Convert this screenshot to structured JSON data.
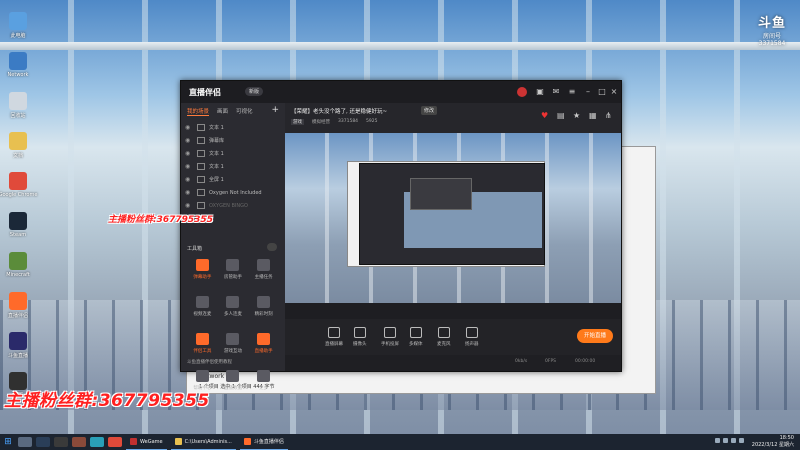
{
  "desktop": {
    "icons": [
      {
        "label": "此电脑",
        "color": "#5aa0e0"
      },
      {
        "label": "Network",
        "color": "#3b7bc4"
      },
      {
        "label": "回收站",
        "color": "#d0d8e0"
      },
      {
        "label": "文档",
        "color": "#e8c050"
      },
      {
        "label": "Google Chrome",
        "color": "#e04a3a"
      },
      {
        "label": "Steam",
        "color": "#1b2838"
      },
      {
        "label": "Minecraft",
        "color": "#5b8c3a"
      },
      {
        "label": "直播伴侣",
        "color": "#ff6a2a"
      },
      {
        "label": "斗鱼直播",
        "color": "#2a2a6a"
      },
      {
        "label": "OBS",
        "color": "#303030"
      }
    ],
    "watermark": {
      "logo": "斗鱼",
      "text": "房间号",
      "room": "3371584"
    },
    "fan_group_big": "主播粉丝群:367795355",
    "fan_group_small": "主播粉丝群:367795355"
  },
  "background_window": {
    "network_label": "Network",
    "network_sub": "1 个项目    选中 1 个项目   444 字节"
  },
  "app": {
    "logo": "直播伴侣",
    "version": "新版",
    "tabs": [
      "我的场景",
      "画面",
      "可视化"
    ],
    "sources": [
      {
        "label": "文本 1",
        "dim": false
      },
      {
        "label": "弹幕库",
        "dim": false
      },
      {
        "label": "文本 1",
        "dim": false
      },
      {
        "label": "文本 1",
        "dim": false
      },
      {
        "label": "全屏 1",
        "dim": false
      },
      {
        "label": "Oxygen Not Included",
        "dim": false
      },
      {
        "label": "OXYGEN BINGO",
        "dim": true
      }
    ],
    "tools_header": "工具箱",
    "tools": [
      {
        "label": "弹幕助手",
        "orange": true
      },
      {
        "label": "房管助手",
        "orange": false
      },
      {
        "label": "主播任务",
        "orange": false
      },
      {
        "label": "视频连麦",
        "orange": false
      },
      {
        "label": "多人连麦",
        "orange": false
      },
      {
        "label": "精彩时刻",
        "orange": false
      },
      {
        "label": "伴侣工具",
        "orange": true
      },
      {
        "label": "游戏互动",
        "orange": false
      },
      {
        "label": "直播助手",
        "orange": true
      },
      {
        "label": "帮助中心",
        "orange": false
      },
      {
        "label": "直播数据",
        "orange": false
      },
      {
        "label": "更多",
        "orange": false
      }
    ],
    "sidebar_footer": "斗鱼直播伴侣使用教程",
    "room_title": "【荣耀】老头没个路了, 还是稳健好玩~",
    "edit_label": "修改",
    "room_meta": {
      "category": "游戏",
      "area": "模拟经营",
      "room_id": "3371584",
      "viewers": "5925"
    },
    "controls": [
      "直播屏幕",
      "摄像头",
      "手机投屏",
      "多媒体",
      "麦克风",
      "扬声器"
    ],
    "start_live": "开始直播",
    "status": {
      "bitrate": "0kb/s",
      "fps": "0FPS",
      "time": "00:00:00"
    }
  },
  "taskbar": {
    "tasks": [
      {
        "label": "WeGame",
        "color": "#c03030"
      },
      {
        "label": "C:\\Users\\Adminis...",
        "color": "#e8c050"
      },
      {
        "label": "斗鱼直播伴侣",
        "color": "#ff6a2a"
      }
    ],
    "time": "18:50",
    "date": "2022/3/12 星期六"
  }
}
